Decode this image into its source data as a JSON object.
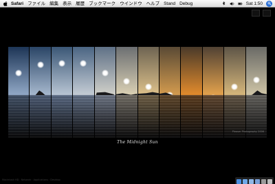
{
  "menubar": {
    "app_name": "Safari",
    "menus": [
      "ファイル",
      "編集",
      "表示",
      "履歴",
      "ブックマーク",
      "ウインドウ",
      "ヘルプ",
      "Stand",
      "Debug"
    ],
    "clock": "Sat 1:50"
  },
  "wallpaper": {
    "caption": "The Midnight Sun",
    "credit": "Pleaser Photography 2006",
    "strip_colors": [
      {
        "sky_top": "#1d3556",
        "sky_bottom": "#8fa6c4",
        "water": "#3e4d63",
        "sun_y": 0.28
      },
      {
        "sky_top": "#2a4566",
        "sky_bottom": "#a4b6cc",
        "water": "#4a5972",
        "sun_y": 0.18
      },
      {
        "sky_top": "#3b5776",
        "sky_bottom": "#b6c3d2",
        "water": "#566680",
        "sun_y": 0.16
      },
      {
        "sky_top": "#4b6583",
        "sky_bottom": "#c2cad3",
        "water": "#5f6d84",
        "sun_y": 0.16
      },
      {
        "sky_top": "#5f7187",
        "sky_bottom": "#cfcfc9",
        "water": "#6a7282",
        "sun_y": 0.28
      },
      {
        "sky_top": "#6c6f72",
        "sky_bottom": "#d9cfb3",
        "water": "#6f6a62",
        "sun_y": 0.38
      },
      {
        "sky_top": "#6e6452",
        "sky_bottom": "#dcc08a",
        "water": "#6c5c42",
        "sun_y": 0.45
      },
      {
        "sky_top": "#5a4a35",
        "sky_bottom": "#d29a4e",
        "water": "#5d4427",
        "sun_y": 0.55
      },
      {
        "sky_top": "#4a3a2a",
        "sky_bottom": "#e08a2c",
        "water": "#5a3a1b",
        "sun_y": 0.6
      },
      {
        "sky_top": "#514234",
        "sky_bottom": "#e0a04c",
        "water": "#5d432b",
        "sun_y": 0.58
      },
      {
        "sky_top": "#5e5547",
        "sky_bottom": "#d4b57a",
        "water": "#5e5140",
        "sun_y": 0.45
      },
      {
        "sky_top": "#6a6a66",
        "sky_bottom": "#cdc3a5",
        "water": "#5f5d58",
        "sun_y": 0.36
      }
    ]
  },
  "footer": {
    "text": "Macintosh HD  ·  Network  ·  Applications  ·  Desktop"
  },
  "dock": {
    "icons": [
      "finder-icon",
      "safari-icon",
      "mail-icon",
      "itunes-icon",
      "system-prefs-icon",
      "trash-icon"
    ],
    "colors": [
      "#4a8ee0",
      "#6fa8e8",
      "#8fb7e6",
      "#7aa0d8",
      "#9a9a9a",
      "#bdbdbd"
    ]
  }
}
